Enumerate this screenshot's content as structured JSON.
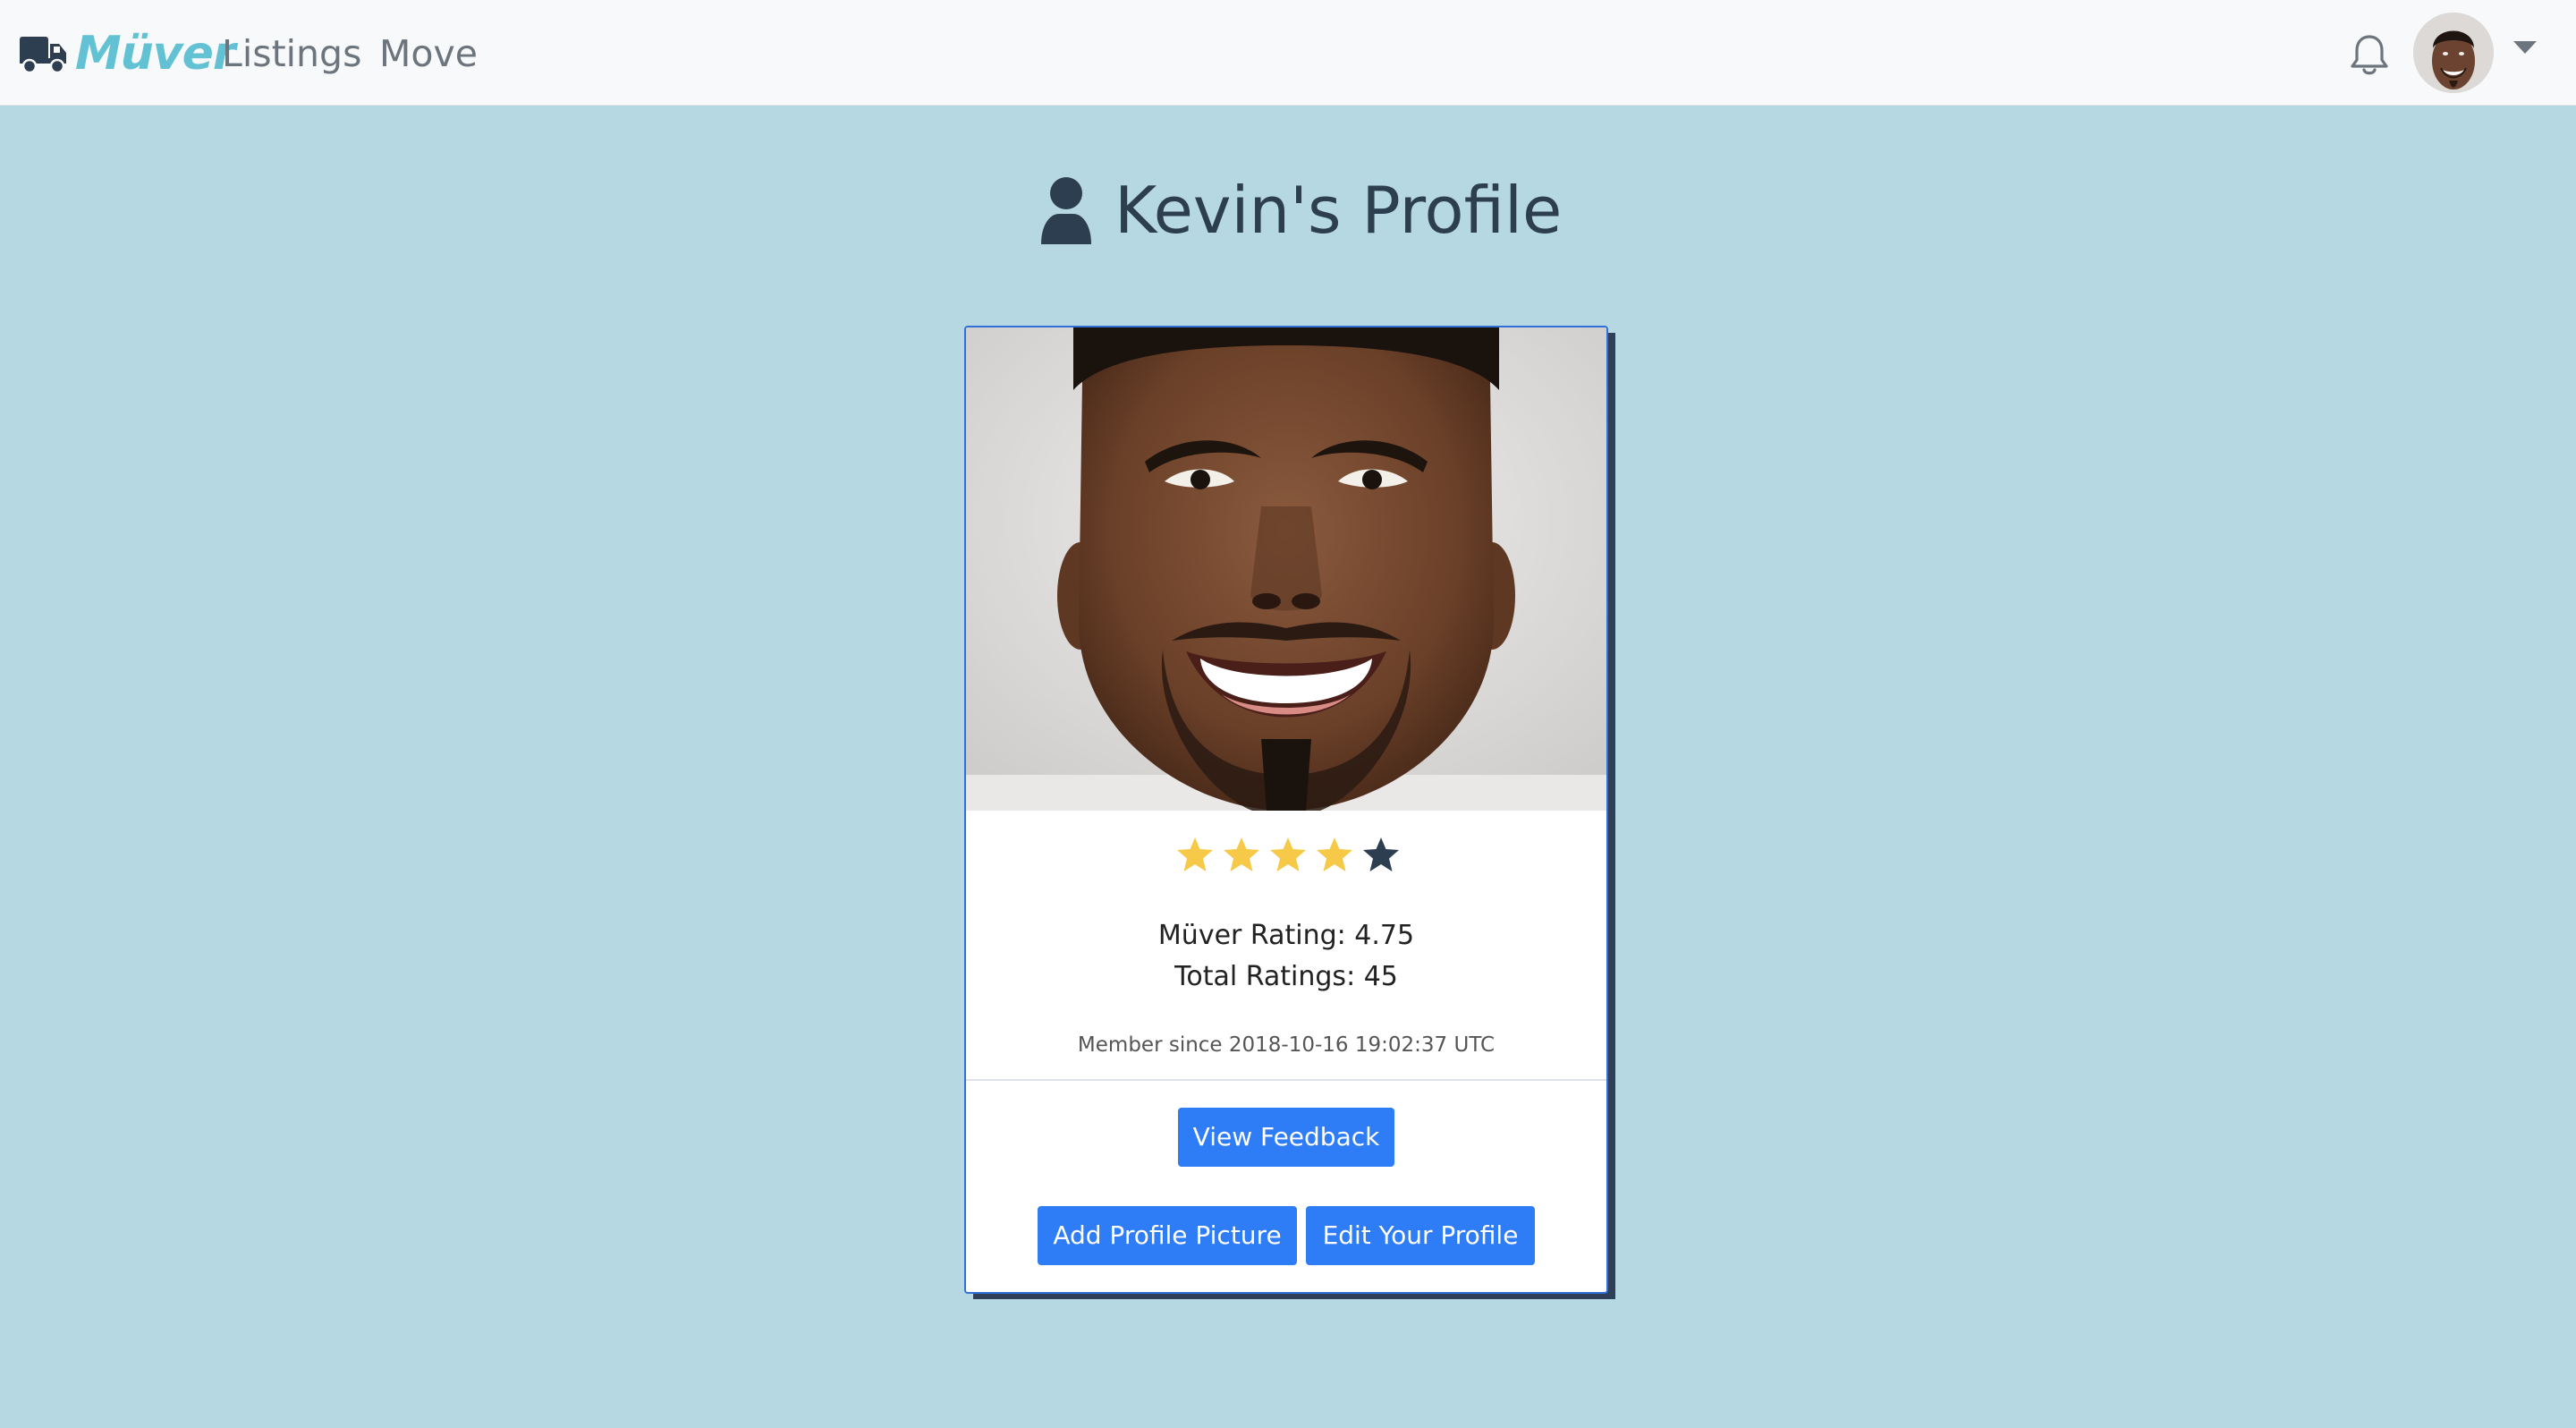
{
  "navbar": {
    "brand": "Müver",
    "links": [
      "Listings",
      "Move"
    ],
    "icons": {
      "logo": "truck-icon",
      "notifications": "bell-icon",
      "user_menu": "chevron-down-icon"
    }
  },
  "heading": {
    "icon": "user-icon",
    "title": "Kevin's Profile"
  },
  "profile": {
    "rating_stars": 4,
    "rating_stars_max": 5,
    "rating_label": "Müver Rating: 4.75",
    "total_label": "Total Ratings: 45",
    "member_since": "Member since 2018-10-16 19:02:37 UTC"
  },
  "actions": {
    "view_feedback": "View Feedback",
    "add_picture": "Add Profile Picture",
    "edit_profile": "Edit Your Profile"
  },
  "colors": {
    "background": "#b5d8e3",
    "brand": "#62c2d4",
    "primary_button": "#2e7cf6",
    "star_filled": "#f7c948",
    "star_empty": "#2d3e50",
    "heading_text": "#2d3e50"
  }
}
